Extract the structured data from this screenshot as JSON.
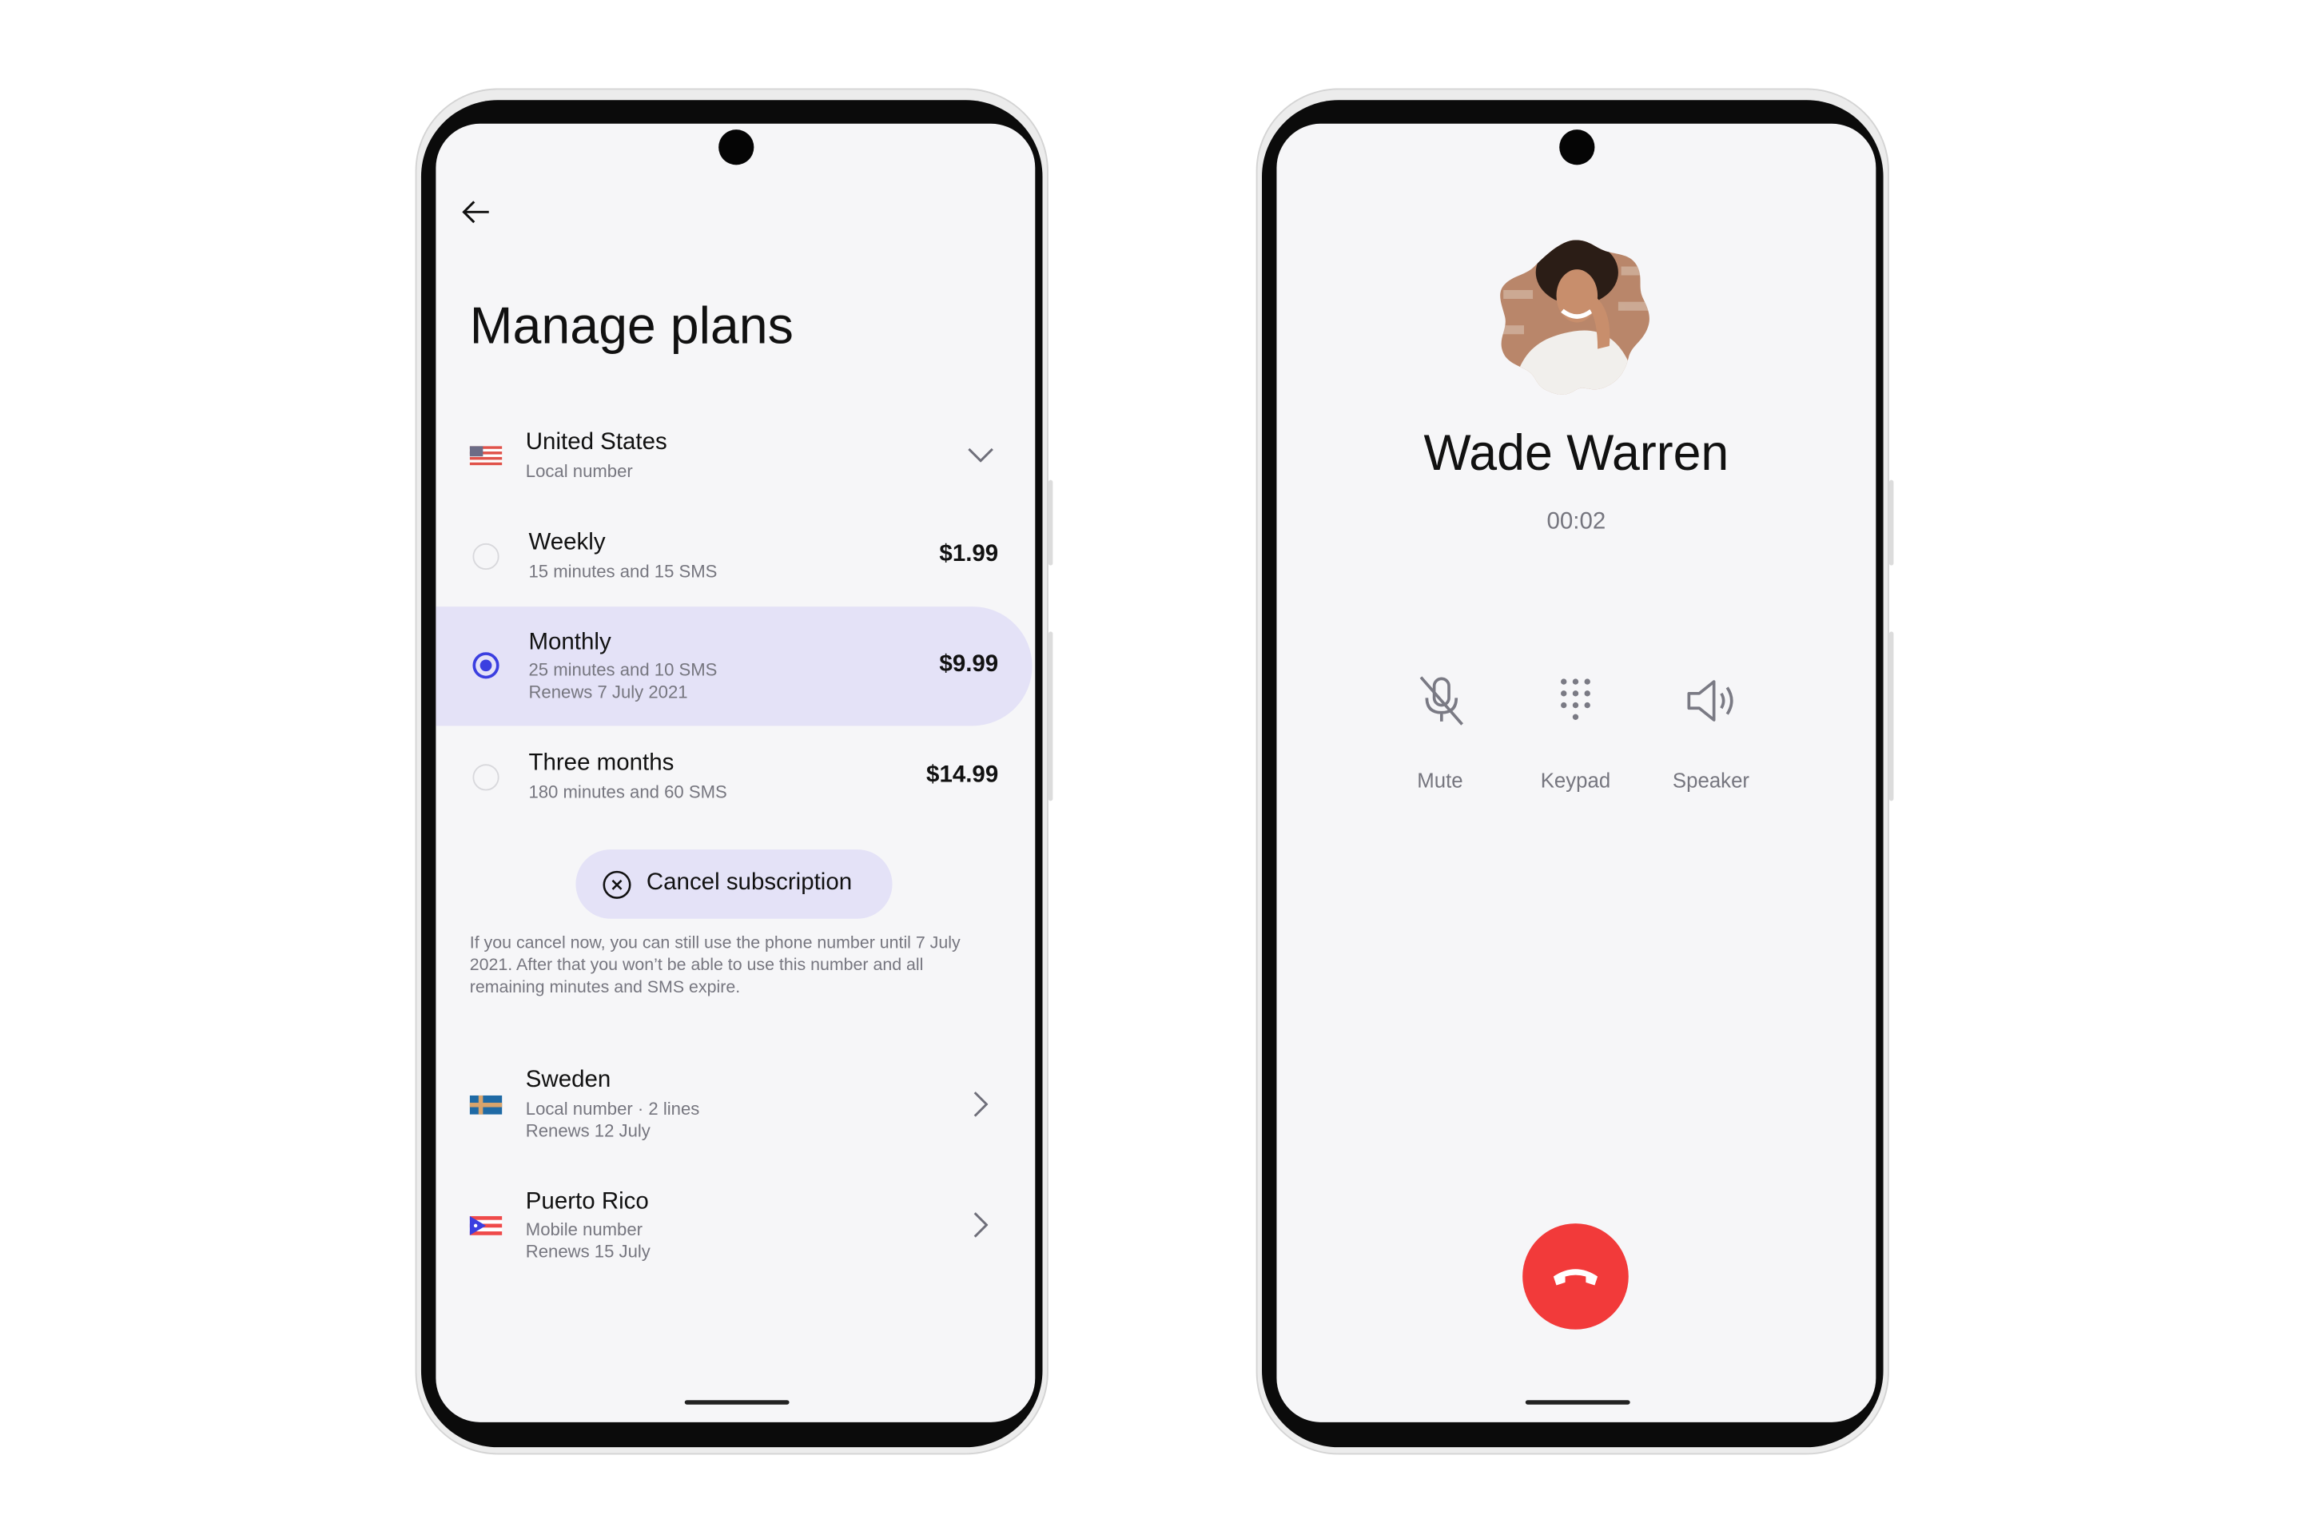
{
  "manage_plans": {
    "title": "Manage plans",
    "current_country": {
      "name": "United States",
      "type": "Local number",
      "flag": "us-flag-icon"
    },
    "plans": [
      {
        "name": "Weekly",
        "details": [
          "15 minutes and 15 SMS"
        ],
        "price": "$1.99",
        "selected": false
      },
      {
        "name": "Monthly",
        "details": [
          "25 minutes and 10 SMS",
          "Renews 7 July 2021"
        ],
        "price": "$9.99",
        "selected": true
      },
      {
        "name": "Three months",
        "details": [
          "180 minutes and 60 SMS"
        ],
        "price": "$14.99",
        "selected": false
      }
    ],
    "cancel_button": "Cancel subscription",
    "cancel_note": "If you cancel now, you can still use the phone number until 7 July 2021. After that you won’t be able to use this number and all remaining minutes and SMS expire.",
    "other_numbers": [
      {
        "name": "Sweden",
        "line1": "Local number · 2 lines",
        "line2": "Renews 12 July",
        "flag": "sweden-flag-icon"
      },
      {
        "name": "Puerto Rico",
        "line1": "Mobile number",
        "line2": "Renews 15 July",
        "flag": "puerto-rico-flag-icon"
      }
    ]
  },
  "call": {
    "contact_name": "Wade Warren",
    "duration": "00:02",
    "actions": [
      {
        "label": "Mute",
        "icon": "mic-off-icon"
      },
      {
        "label": "Keypad",
        "icon": "keypad-icon"
      },
      {
        "label": "Speaker",
        "icon": "speaker-icon"
      }
    ],
    "end_call_icon": "end-call-icon"
  },
  "colors": {
    "accent": "#3b3fe0",
    "selected_bg": "#e4e2f7",
    "end_call": "#f23a3a",
    "screen_bg": "#f6f6f8"
  }
}
